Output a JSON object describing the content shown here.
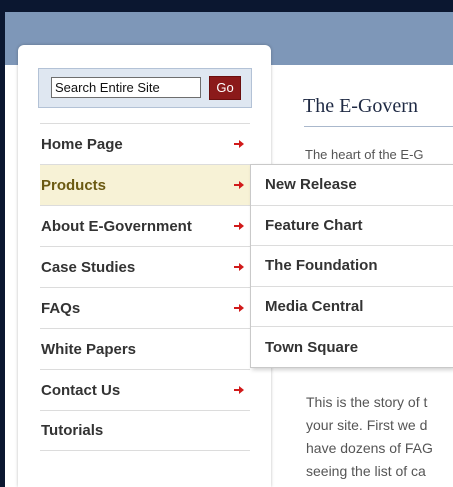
{
  "page": {
    "title": "The E-Govern",
    "intro": "The heart of the E-G",
    "story_lines": [
      "This is the story of t",
      "your site. First we d",
      "have dozens of FAG",
      "seeing the list of ca"
    ]
  },
  "search": {
    "value": "Search Entire Site",
    "button_label": "Go"
  },
  "nav": {
    "items": [
      {
        "label": "Home Page",
        "has_arrow": true
      },
      {
        "label": "Products",
        "has_arrow": true,
        "active": true
      },
      {
        "label": "About E-Government",
        "has_arrow": true
      },
      {
        "label": "Case Studies",
        "has_arrow": true
      },
      {
        "label": "FAQs",
        "has_arrow": true
      },
      {
        "label": "White Papers",
        "has_arrow": false
      },
      {
        "label": "Contact Us",
        "has_arrow": true
      },
      {
        "label": "Tutorials",
        "has_arrow": false
      }
    ]
  },
  "submenu": {
    "items": [
      {
        "label": "New Release"
      },
      {
        "label": "Feature Chart"
      },
      {
        "label": "The Foundation"
      },
      {
        "label": "Media Central"
      },
      {
        "label": "Town Square"
      }
    ]
  },
  "colors": {
    "header_band": "#7e97b8",
    "frame": "#0b1730",
    "accent_red": "#d11a1a",
    "go_button": "#8b1a1a",
    "active_item_bg": "#f7f2d6"
  },
  "icons": {
    "nav_arrow": "arrow-right-icon"
  }
}
